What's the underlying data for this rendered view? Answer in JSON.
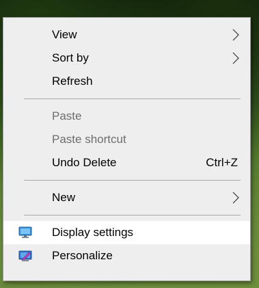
{
  "menu": {
    "items": [
      {
        "label": "View",
        "submenu": true
      },
      {
        "label": "Sort by",
        "submenu": true
      },
      {
        "label": "Refresh"
      },
      {
        "label": "Paste",
        "disabled": true
      },
      {
        "label": "Paste shortcut",
        "disabled": true
      },
      {
        "label": "Undo Delete",
        "shortcut": "Ctrl+Z"
      },
      {
        "label": "New",
        "submenu": true
      },
      {
        "label": "Display settings",
        "icon": "display-settings-icon",
        "highlighted": true
      },
      {
        "label": "Personalize",
        "icon": "personalize-icon"
      }
    ]
  },
  "colors": {
    "menu_background": "#eeeeee",
    "highlight_background": "#ffffff",
    "disabled_text": "#6d6d6d",
    "separator": "#a8a8a8"
  }
}
